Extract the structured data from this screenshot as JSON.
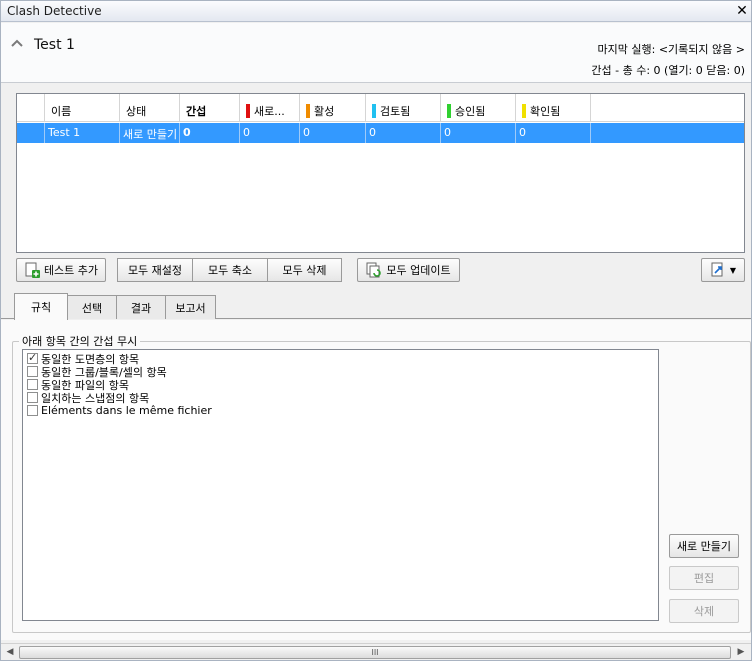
{
  "window": {
    "title": "Clash Detective",
    "close_glyph": "✕"
  },
  "header": {
    "test_name": "Test 1",
    "last_run": "마지막 실행:  <기록되지 않음 >",
    "summary": "간섭 - 총 수: 0  (열기: 0  닫음: 0)"
  },
  "grid": {
    "columns": [
      {
        "label": "",
        "color": ""
      },
      {
        "label": "이름",
        "color": ""
      },
      {
        "label": "상태",
        "color": ""
      },
      {
        "label": "간섭",
        "color": ""
      },
      {
        "label": "새로...",
        "color": "#e01010"
      },
      {
        "label": "활성",
        "color": "#f08c00"
      },
      {
        "label": "검토됨",
        "color": "#20c0f0"
      },
      {
        "label": "승인됨",
        "color": "#30d030"
      },
      {
        "label": "확인됨",
        "color": "#f0e000"
      }
    ],
    "rows": [
      [
        "",
        "Test 1",
        "새로 만들기",
        "0",
        "0",
        "0",
        "0",
        "0",
        "0"
      ]
    ]
  },
  "toolbar": {
    "add_test": "테스트 추가",
    "reset_all": "모두 재설정",
    "compact_all": "모두 축소",
    "delete_all": "모두 삭제",
    "update_all": "모두 업데이트"
  },
  "tabs": [
    "규칙",
    "선택",
    "결과",
    "보고서"
  ],
  "rules": {
    "group_label": "아래 항목 간의 간섭 무시",
    "items": [
      {
        "label": "동일한 도면층의 항목",
        "checked": true
      },
      {
        "label": "동일한 그룹/블록/셀의 항목",
        "checked": false
      },
      {
        "label": "동일한 파일의 항목",
        "checked": false
      },
      {
        "label": "일치하는 스냅점의 항목",
        "checked": false
      },
      {
        "label": "Eléments dans le même fichier",
        "checked": false
      }
    ],
    "new_button": "새로 만들기",
    "edit_button": "편집",
    "delete_button": "삭제"
  },
  "scrollbar": {
    "grip": "III"
  },
  "colors": {
    "selection": "#3399ff",
    "accent": "#1e6fd0"
  }
}
